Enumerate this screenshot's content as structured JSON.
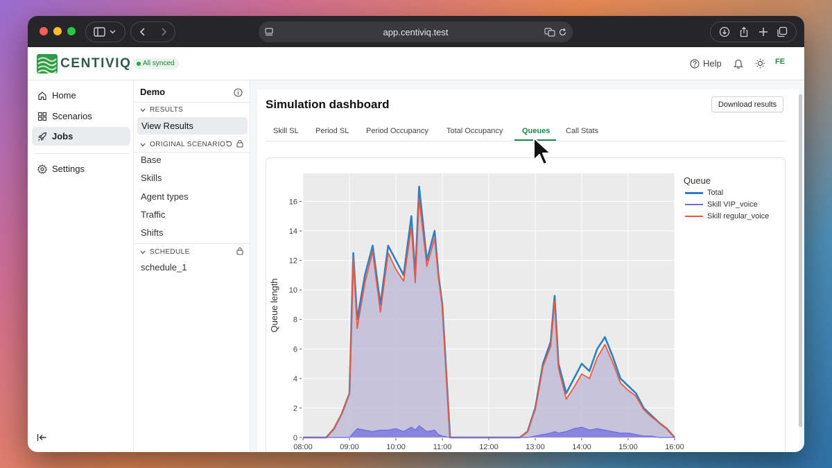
{
  "browser": {
    "url": "app.centiviq.test"
  },
  "brand": {
    "name": "CENTIVIQ",
    "sync_status": "All synced",
    "accent": "#1f8a4c"
  },
  "topbar": {
    "help_label": "Help",
    "user_initials": "FE"
  },
  "nav": {
    "items": [
      {
        "label": "Home",
        "icon": "home-icon"
      },
      {
        "label": "Scenarios",
        "icon": "scenarios-icon"
      },
      {
        "label": "Jobs",
        "icon": "rocket-icon",
        "active": true
      },
      {
        "label": "Settings",
        "icon": "gear-icon"
      }
    ]
  },
  "project": {
    "title": "Demo",
    "results_header": "RESULTS",
    "view_results": "View Results",
    "original_header": "ORIGINAL SCENARIO",
    "scenario_items": [
      "Base",
      "Skills",
      "Agent types",
      "Traffic",
      "Shifts"
    ],
    "schedule_header": "SCHEDULE",
    "schedule_items": [
      "schedule_1"
    ]
  },
  "dashboard": {
    "title": "Simulation dashboard",
    "download_label": "Download results",
    "tabs": [
      "Skill SL",
      "Period SL",
      "Period Occupancy",
      "Total Occupancy",
      "Queues",
      "Call Stats"
    ],
    "active_tab": "Queues"
  },
  "chart_data": {
    "type": "line",
    "title": "",
    "xlabel": "",
    "ylabel": "Queue length",
    "legend_title": "Queue",
    "legend_position": "right",
    "grid": true,
    "x_ticks": [
      "08:00",
      "09:00",
      "10:00",
      "11:00",
      "12:00",
      "13:00",
      "14:00",
      "15:00",
      "16:00"
    ],
    "y_ticks": [
      0,
      2,
      4,
      6,
      8,
      10,
      12,
      14,
      16
    ],
    "ylim": [
      0,
      17.9
    ],
    "xlim": [
      "08:00",
      "16:00"
    ],
    "x": [
      "08:00",
      "08:30",
      "08:40",
      "08:50",
      "09:00",
      "09:05",
      "09:10",
      "09:20",
      "09:30",
      "09:40",
      "09:50",
      "10:00",
      "10:10",
      "10:20",
      "10:25",
      "10:30",
      "10:40",
      "10:50",
      "10:55",
      "11:00",
      "11:10",
      "12:00",
      "12:40",
      "12:50",
      "13:00",
      "13:10",
      "13:20",
      "13:25",
      "13:30",
      "13:40",
      "13:50",
      "14:00",
      "14:10",
      "14:20",
      "14:30",
      "14:40",
      "14:50",
      "15:00",
      "15:10",
      "15:20",
      "15:30",
      "15:40",
      "15:50",
      "16:00"
    ],
    "series": [
      {
        "name": "Total",
        "color": "#2f7fc1",
        "values": [
          0,
          0,
          0.6,
          1.6,
          3,
          12.5,
          8,
          11,
          13,
          9,
          13,
          12,
          11,
          15,
          11,
          17,
          12,
          14,
          11,
          9,
          0,
          0,
          0,
          0.4,
          2,
          5,
          6.5,
          9.6,
          5,
          3,
          4,
          5,
          4.5,
          6,
          6.8,
          5.5,
          4,
          3.5,
          3,
          2,
          1.5,
          1,
          0.6,
          0
        ]
      },
      {
        "name": "Skill VIP_voice",
        "color": "#6f6ae0",
        "values": [
          0,
          0,
          0,
          0,
          0,
          0.3,
          0.6,
          0.5,
          0.4,
          0.5,
          0.5,
          0.6,
          0.4,
          0.7,
          0.5,
          0.8,
          0.4,
          0.5,
          0.2,
          0.1,
          0,
          0,
          0,
          0,
          0.1,
          0.2,
          0.3,
          0.4,
          0.3,
          0.4,
          0.6,
          0.7,
          0.5,
          0.6,
          0.5,
          0.4,
          0.3,
          0.3,
          0.2,
          0.1,
          0.1,
          0,
          0,
          0
        ]
      },
      {
        "name": "Skill regular_voice",
        "color": "#ea5a3e",
        "values": [
          0,
          0,
          0.6,
          1.6,
          3,
          12.2,
          7.4,
          10.5,
          12.6,
          8.5,
          12.5,
          11.4,
          10.6,
          14.3,
          10.5,
          16.2,
          11.6,
          13.5,
          10.8,
          8.9,
          0,
          0,
          0,
          0.4,
          1.9,
          4.8,
          6.2,
          9.2,
          4.7,
          2.6,
          3.4,
          4.3,
          4,
          5.4,
          6.3,
          5.1,
          3.7,
          3.2,
          2.8,
          1.9,
          1.4,
          1,
          0.6,
          0
        ]
      }
    ]
  }
}
